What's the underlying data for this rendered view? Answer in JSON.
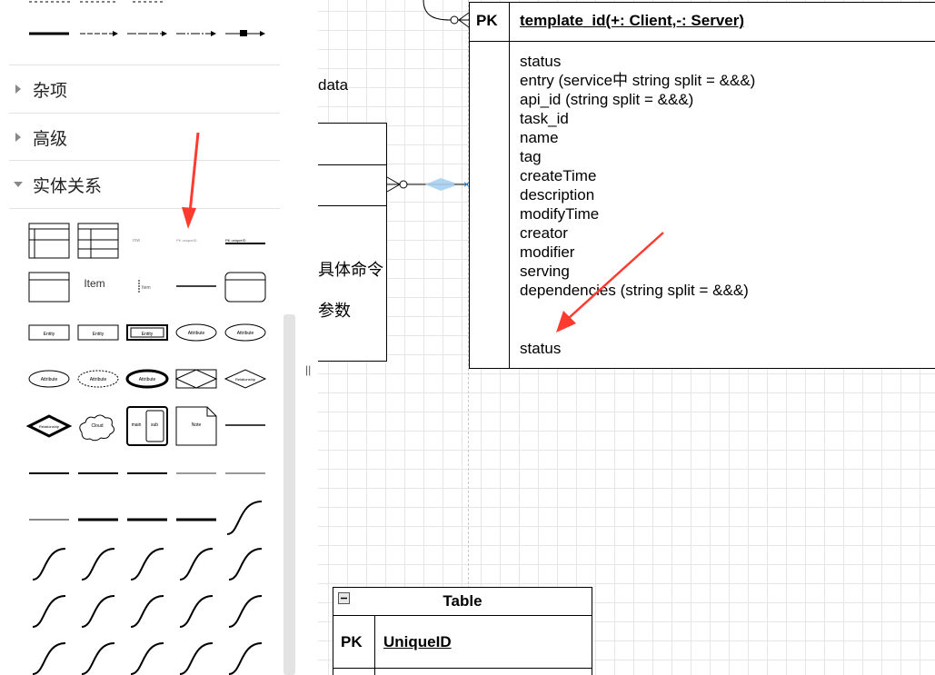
{
  "sidebar": {
    "sections": [
      {
        "label": "杂项",
        "expanded": false
      },
      {
        "label": "高级",
        "expanded": false
      },
      {
        "label": "实体关系",
        "expanded": true
      }
    ],
    "shape_texts": {
      "item": "Item",
      "item_small": "Item",
      "entity": "Entity",
      "attribute": "Attribute",
      "relationship": "Relationship",
      "cloud": "Cloud",
      "main": "main",
      "sub": "sub",
      "note": "Note"
    }
  },
  "splitter": {
    "handle": "||"
  },
  "canvas": {
    "main_entity": {
      "pk_label": "PK",
      "pk_field": "template_id(+: Client,-: Server)",
      "fields": [
        "status",
        "entry (service中 string split = &&&)",
        "api_id (string split = &&&)",
        "task_id",
        "name",
        "tag",
        "createTime",
        "description",
        "modifyTime",
        "creator",
        "modifier",
        "serving",
        "dependencies (string split = &&&)"
      ],
      "last_field": "status"
    },
    "left_entity": {
      "partial_label": "data",
      "command_text": "具体命令",
      "param_text": "参数"
    },
    "table_entity": {
      "title": "Table",
      "pk_label": "PK",
      "pk_field": "UniqueID"
    }
  },
  "colors": {
    "annotation_arrow": "#ff3b30",
    "connection_point": "#2a8bd8",
    "grid": "#e6e6e6"
  }
}
